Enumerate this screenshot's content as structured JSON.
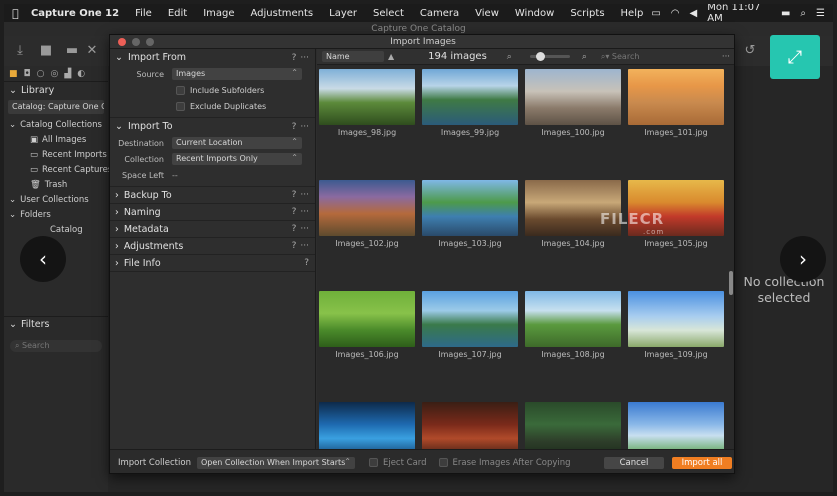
{
  "menubar": {
    "app_name": "Capture One 12",
    "items": [
      "File",
      "Edit",
      "Image",
      "Adjustments",
      "Layer",
      "Select",
      "Camera",
      "View",
      "Window",
      "Scripts",
      "Help"
    ],
    "clock": "Mon 11:07 AM"
  },
  "window": {
    "title": "Capture One Catalog"
  },
  "sidebar": {
    "library_label": "Library",
    "catalog_label": "Catalog: Capture One Cat",
    "catalog_collections_label": "Catalog Collections",
    "items": [
      "All Images",
      "Recent Imports",
      "Recent Captures",
      "Trash"
    ],
    "user_collections_label": "User Collections",
    "folders_label": "Folders",
    "folder_child": "Catalog",
    "filters_label": "Filters",
    "search_placeholder": "Search"
  },
  "right_panel": {
    "no_collection_line1": "No collection",
    "no_collection_line2": "selected"
  },
  "dialog": {
    "title": "Import Images",
    "import_from": {
      "label": "Import From",
      "source_label": "Source",
      "source_value": "Images",
      "include_subfolders": "Include Subfolders",
      "exclude_duplicates": "Exclude Duplicates"
    },
    "import_to": {
      "label": "Import To",
      "destination_label": "Destination",
      "destination_value": "Current Location",
      "collection_label": "Collection",
      "collection_value": "Recent Imports Only",
      "space_left_label": "Space Left",
      "space_left_value": "--"
    },
    "sections": [
      "Backup To",
      "Naming",
      "Metadata",
      "Adjustments",
      "File Info"
    ],
    "grid": {
      "sort_value": "Name",
      "count_label": "194 images",
      "search_placeholder": "Search",
      "images": [
        "Images_98.jpg",
        "Images_99.jpg",
        "Images_100.jpg",
        "Images_101.jpg",
        "Images_102.jpg",
        "Images_103.jpg",
        "Images_104.jpg",
        "Images_105.jpg",
        "Images_106.jpg",
        "Images_107.jpg",
        "Images_108.jpg",
        "Images_109.jpg",
        "",
        "",
        "",
        ""
      ]
    },
    "bottom": {
      "import_collection_label": "Import Collection",
      "import_collection_value": "Open Collection When Import Starts",
      "eject_card": "Eject Card",
      "erase_images": "Erase Images After Copying",
      "cancel_label": "Cancel",
      "import_label": "Import all"
    }
  },
  "watermark": {
    "text": "FILECR",
    "sub": ".com"
  },
  "colors": {
    "accent_orange": "#f07e22",
    "fullscreen_teal": "#26c6b0"
  }
}
